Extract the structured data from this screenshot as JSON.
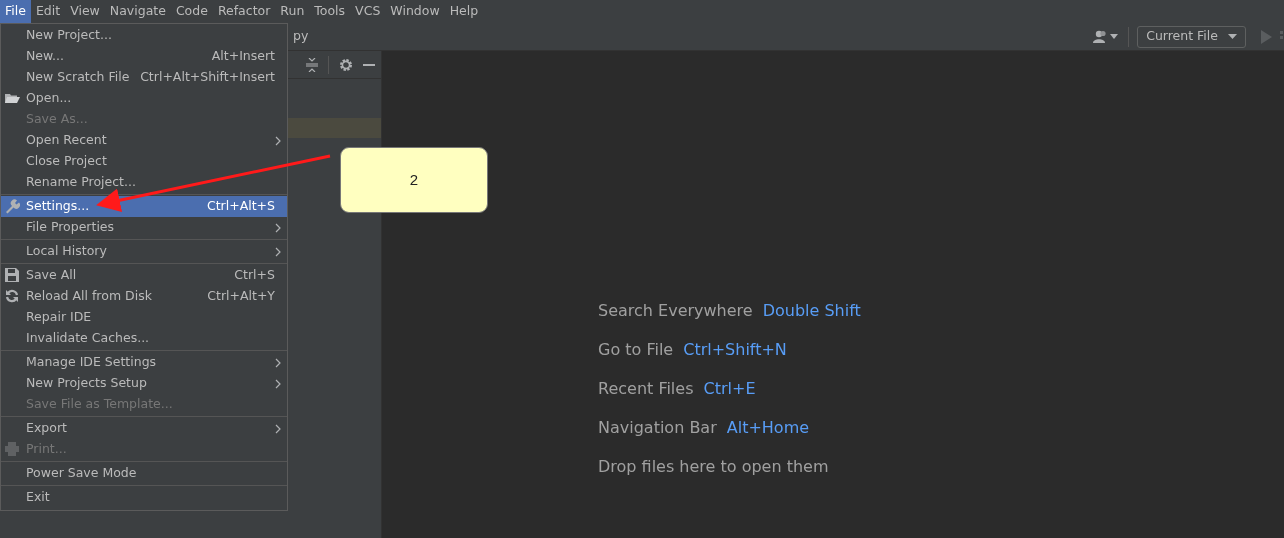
{
  "menu_bar": [
    {
      "label": "File",
      "selected": true
    },
    {
      "label": "Edit",
      "selected": false
    },
    {
      "label": "View",
      "selected": false
    },
    {
      "label": "Navigate",
      "selected": false
    },
    {
      "label": "Code",
      "selected": false
    },
    {
      "label": "Refactor",
      "selected": false
    },
    {
      "label": "Run",
      "selected": false
    },
    {
      "label": "Tools",
      "selected": false
    },
    {
      "label": "VCS",
      "selected": false
    },
    {
      "label": "Window",
      "selected": false
    },
    {
      "label": "Help",
      "selected": false
    }
  ],
  "toolbar": {
    "breadcrumb_fragment": "py",
    "run_config": "Current File"
  },
  "file_menu": [
    [
      {
        "label": "New Project...",
        "submenu": false,
        "disabled": false,
        "selected": false
      },
      {
        "label": "New...",
        "shortcut": "Alt+Insert",
        "submenu": false,
        "disabled": false,
        "selected": false
      },
      {
        "label": "New Scratch File",
        "shortcut": "Ctrl+Alt+Shift+Insert",
        "submenu": false,
        "disabled": false,
        "selected": false
      },
      {
        "label": "Open...",
        "submenu": false,
        "disabled": false,
        "selected": false
      },
      {
        "label": "Save As...",
        "submenu": false,
        "disabled": true,
        "selected": false
      },
      {
        "label": "Open Recent",
        "submenu": true,
        "disabled": false,
        "selected": false
      },
      {
        "label": "Close Project",
        "submenu": false,
        "disabled": false,
        "selected": false
      },
      {
        "label": "Rename Project...",
        "submenu": false,
        "disabled": false,
        "selected": false
      }
    ],
    [
      {
        "label": "Settings...",
        "shortcut": "Ctrl+Alt+S",
        "submenu": false,
        "disabled": false,
        "selected": true
      },
      {
        "label": "File Properties",
        "submenu": true,
        "disabled": false,
        "selected": false
      }
    ],
    [
      {
        "label": "Local History",
        "submenu": true,
        "disabled": false,
        "selected": false
      }
    ],
    [
      {
        "label": "Save All",
        "shortcut": "Ctrl+S",
        "submenu": false,
        "disabled": false,
        "selected": false
      },
      {
        "label": "Reload All from Disk",
        "shortcut": "Ctrl+Alt+Y",
        "submenu": false,
        "disabled": false,
        "selected": false
      },
      {
        "label": "Repair IDE",
        "submenu": false,
        "disabled": false,
        "selected": false
      },
      {
        "label": "Invalidate Caches...",
        "submenu": false,
        "disabled": false,
        "selected": false
      }
    ],
    [
      {
        "label": "Manage IDE Settings",
        "submenu": true,
        "disabled": false,
        "selected": false
      },
      {
        "label": "New Projects Setup",
        "submenu": true,
        "disabled": false,
        "selected": false
      },
      {
        "label": "Save File as Template...",
        "submenu": false,
        "disabled": true,
        "selected": false
      }
    ],
    [
      {
        "label": "Export",
        "submenu": true,
        "disabled": false,
        "selected": false
      },
      {
        "label": "Print...",
        "submenu": false,
        "disabled": true,
        "selected": false
      }
    ],
    [
      {
        "label": "Power Save Mode",
        "submenu": false,
        "disabled": false,
        "selected": false
      }
    ],
    [
      {
        "label": "Exit",
        "submenu": false,
        "disabled": false,
        "selected": false
      }
    ]
  ],
  "callout": {
    "label": "2"
  },
  "editor_hints": [
    {
      "label": "Search Everywhere",
      "shortcut": "Double Shift"
    },
    {
      "label": "Go to File",
      "shortcut": "Ctrl+Shift+N"
    },
    {
      "label": "Recent Files",
      "shortcut": "Ctrl+E"
    },
    {
      "label": "Navigation Bar",
      "shortcut": "Alt+Home"
    },
    {
      "label": "Drop files here to open them"
    }
  ]
}
